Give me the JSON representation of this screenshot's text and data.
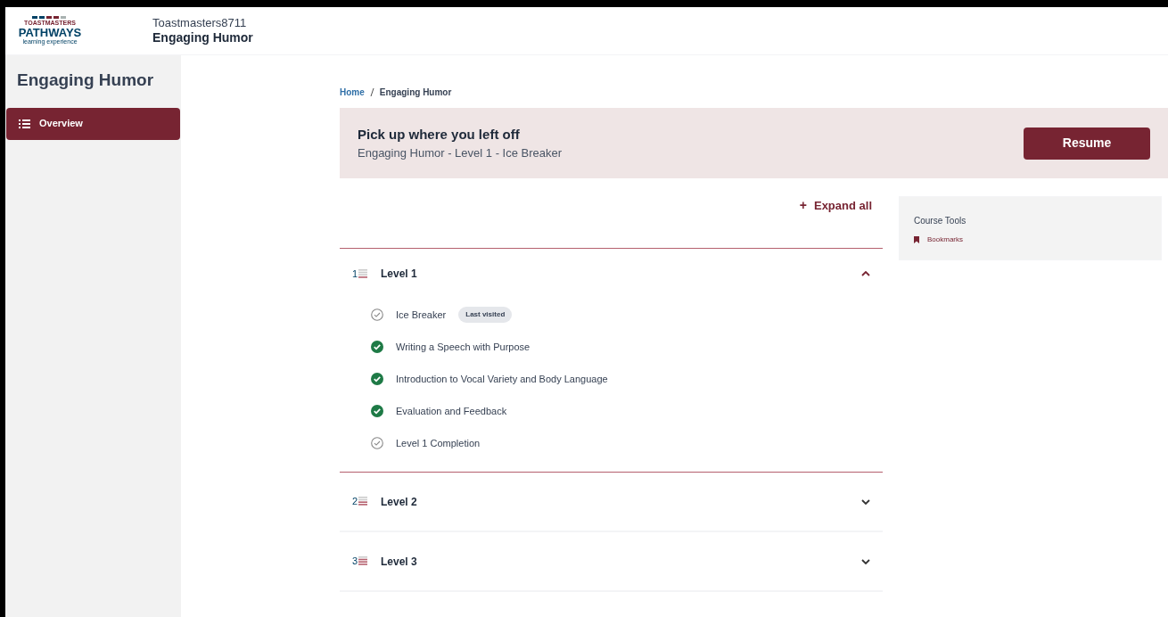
{
  "header": {
    "logo": {
      "brand": "TOASTMASTERS",
      "name": "PATHWAYS",
      "tagline": "learning experience"
    },
    "club": "Toastmasters8711",
    "course": "Engaging Humor"
  },
  "sidebar": {
    "title": "Engaging Humor",
    "items": [
      {
        "label": "Overview",
        "selected": true
      }
    ]
  },
  "breadcrumb": [
    {
      "label": "Home",
      "link": true
    },
    {
      "label": "Engaging Humor",
      "link": false
    }
  ],
  "resume_banner": {
    "title": "Pick up where you left off",
    "subtitle": "Engaging Humor - Level 1 - Ice Breaker",
    "button": "Resume"
  },
  "expand_all": {
    "icon": "+",
    "label": "Expand all"
  },
  "levels": [
    {
      "number": "1",
      "label": "Level 1",
      "expanded": true,
      "items": [
        {
          "label": "Ice Breaker",
          "completed": false,
          "badge": "Last visited"
        },
        {
          "label": "Writing a Speech with Purpose",
          "completed": true
        },
        {
          "label": "Introduction to Vocal Variety and Body Language",
          "completed": true
        },
        {
          "label": "Evaluation and Feedback",
          "completed": true
        },
        {
          "label": "Level 1 Completion",
          "completed": false
        }
      ]
    },
    {
      "number": "2",
      "label": "Level 2",
      "expanded": false
    },
    {
      "number": "3",
      "label": "Level 3",
      "expanded": false
    }
  ],
  "course_tools": {
    "title": "Course Tools",
    "items": [
      {
        "label": "Bookmarks"
      }
    ]
  }
}
